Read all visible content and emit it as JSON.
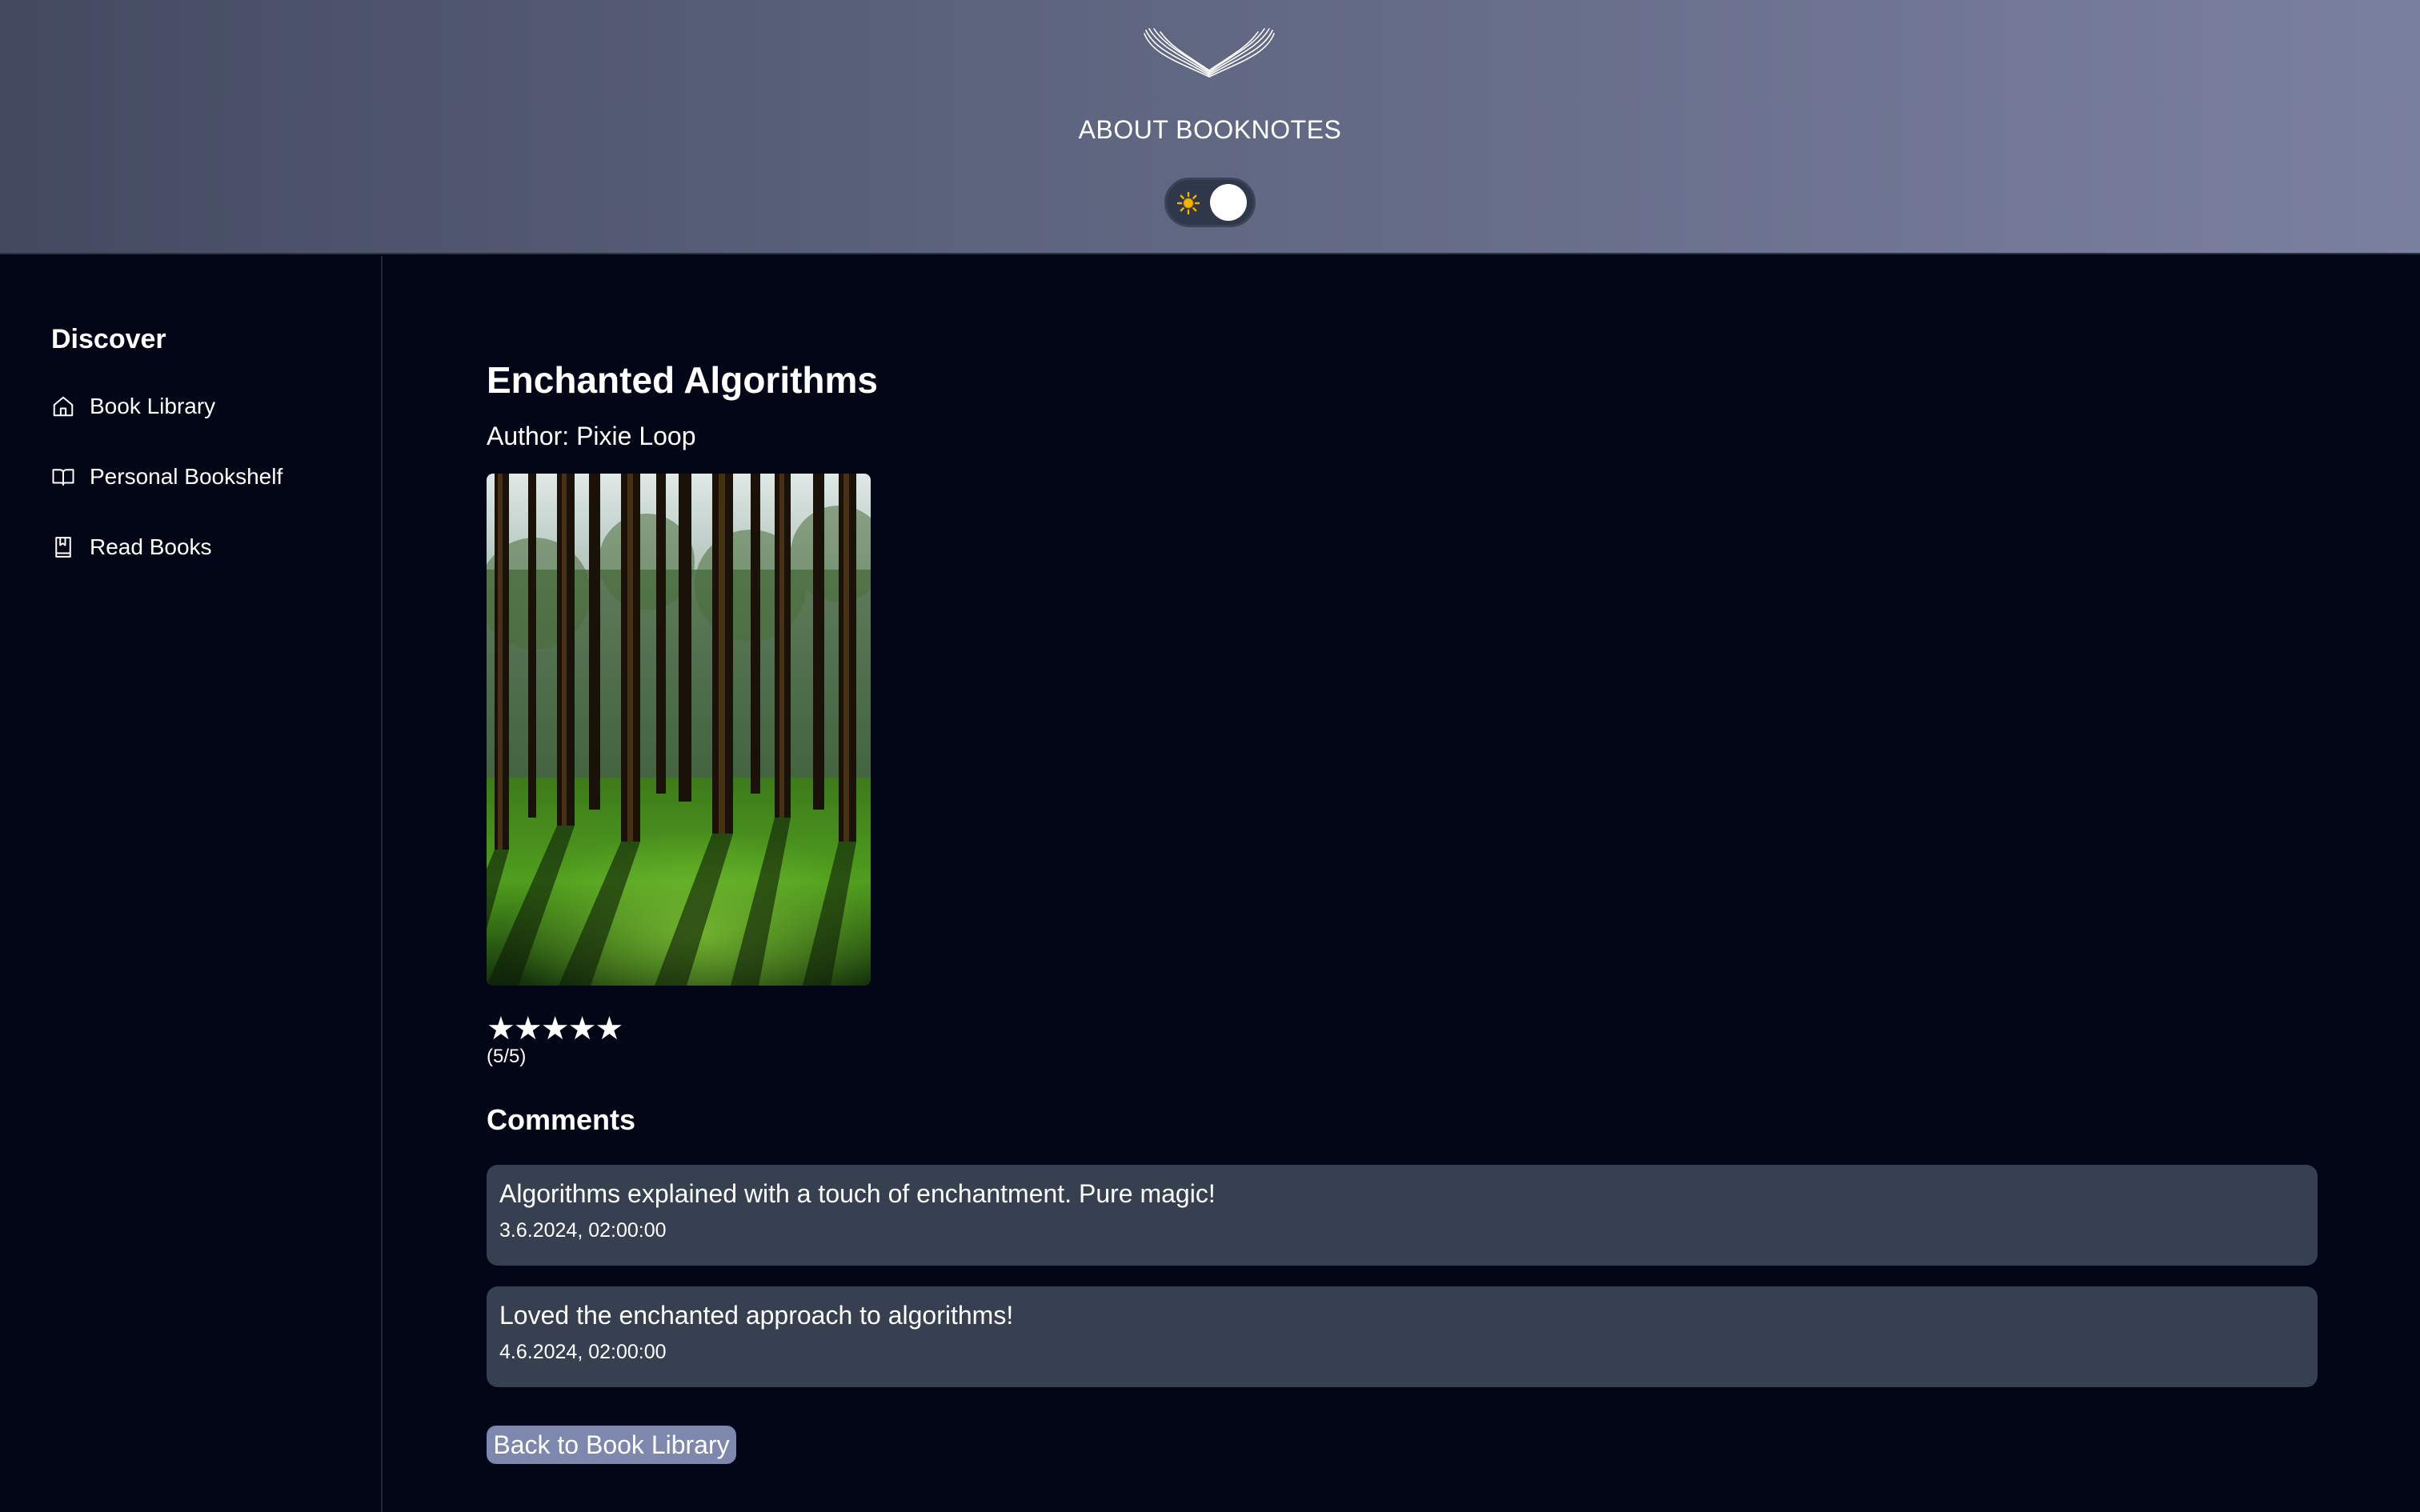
{
  "header": {
    "about_label": "ABOUT BOOKNOTES",
    "logo_icon": "wings-logo-icon",
    "theme_toggle_icon": "sun-icon"
  },
  "sidebar": {
    "title": "Discover",
    "items": [
      {
        "label": "Book Library",
        "icon": "home-icon"
      },
      {
        "label": "Personal Bookshelf",
        "icon": "open-book-icon"
      },
      {
        "label": "Read Books",
        "icon": "bookmark-book-icon"
      }
    ]
  },
  "book": {
    "title": "Enchanted Algorithms",
    "author": "Author: Pixie Loop",
    "stars": "★★★★★",
    "rating": 5,
    "rating_text": "(5/5)"
  },
  "comments": {
    "title": "Comments",
    "items": [
      {
        "text": "Algorithms explained with a touch of enchantment. Pure magic!",
        "date": "3.6.2024, 02:00:00"
      },
      {
        "text": "Loved the enchanted approach to algorithms!",
        "date": "4.6.2024, 02:00:00"
      }
    ]
  },
  "back_button_label": "Back to Book Library",
  "colors": {
    "background": "#020617",
    "comment_bg": "#374050",
    "button_bg": "#7e87ad",
    "sun": "#f5b301"
  }
}
